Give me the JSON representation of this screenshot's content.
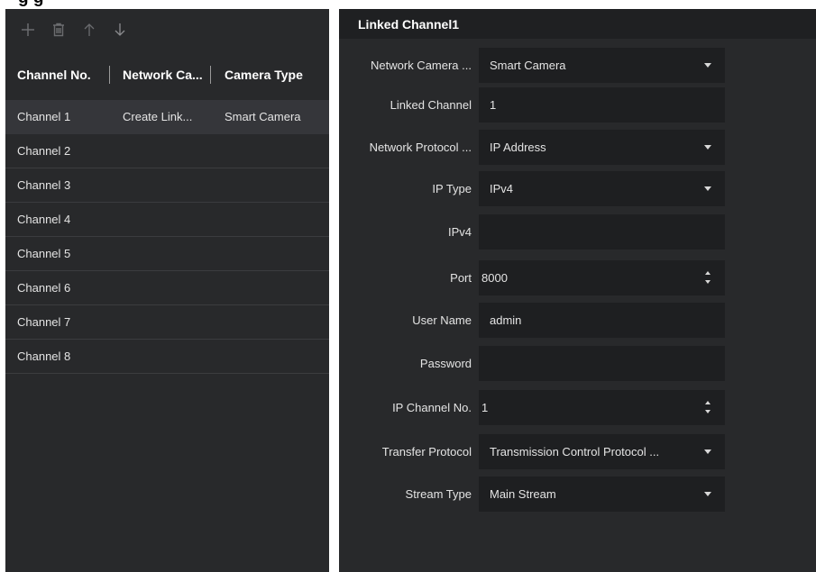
{
  "page_heading_fragment": "g                                g",
  "toolbar": {
    "add_icon": "plus-icon",
    "delete_icon": "trash-icon",
    "up_icon": "arrow-up-icon",
    "down_icon": "arrow-down-icon"
  },
  "table": {
    "headers": [
      "Channel No.",
      "Network Ca...",
      "Camera Type"
    ],
    "rows": [
      {
        "channel": "Channel 1",
        "network": "Create Link...",
        "camera_type": "Smart Camera"
      },
      {
        "channel": "Channel 2",
        "network": "",
        "camera_type": ""
      },
      {
        "channel": "Channel 3",
        "network": "",
        "camera_type": ""
      },
      {
        "channel": "Channel 4",
        "network": "",
        "camera_type": ""
      },
      {
        "channel": "Channel 5",
        "network": "",
        "camera_type": ""
      },
      {
        "channel": "Channel 6",
        "network": "",
        "camera_type": ""
      },
      {
        "channel": "Channel 7",
        "network": "",
        "camera_type": ""
      },
      {
        "channel": "Channel 8",
        "network": "",
        "camera_type": ""
      }
    ]
  },
  "detail": {
    "title": "Linked Channel1",
    "fields": {
      "network_camera": {
        "label": "Network Camera ...",
        "value": "Smart Camera"
      },
      "linked_channel": {
        "label": "Linked Channel",
        "value": "1"
      },
      "network_protocol": {
        "label": "Network Protocol ...",
        "value": "IP Address"
      },
      "ip_type": {
        "label": "IP Type",
        "value": "IPv4"
      },
      "ipv4": {
        "label": "IPv4",
        "value": ""
      },
      "port": {
        "label": "Port",
        "value": "8000"
      },
      "user_name": {
        "label": "User Name",
        "value": "admin"
      },
      "password": {
        "label": "Password",
        "value": ""
      },
      "ip_channel_no": {
        "label": "IP Channel No.",
        "value": "1"
      },
      "transfer_protocol": {
        "label": "Transfer Protocol",
        "value": "Transmission Control Protocol ..."
      },
      "stream_type": {
        "label": "Stream Type",
        "value": "Main Stream"
      }
    }
  },
  "colors": {
    "panel_bg": "#28292b",
    "header_bg": "#1f2022",
    "field_bg": "#1e1f21",
    "selected_row_bg": "#35363a",
    "text": "#e4e4e4",
    "icon_disabled": "#6b6c6f"
  }
}
